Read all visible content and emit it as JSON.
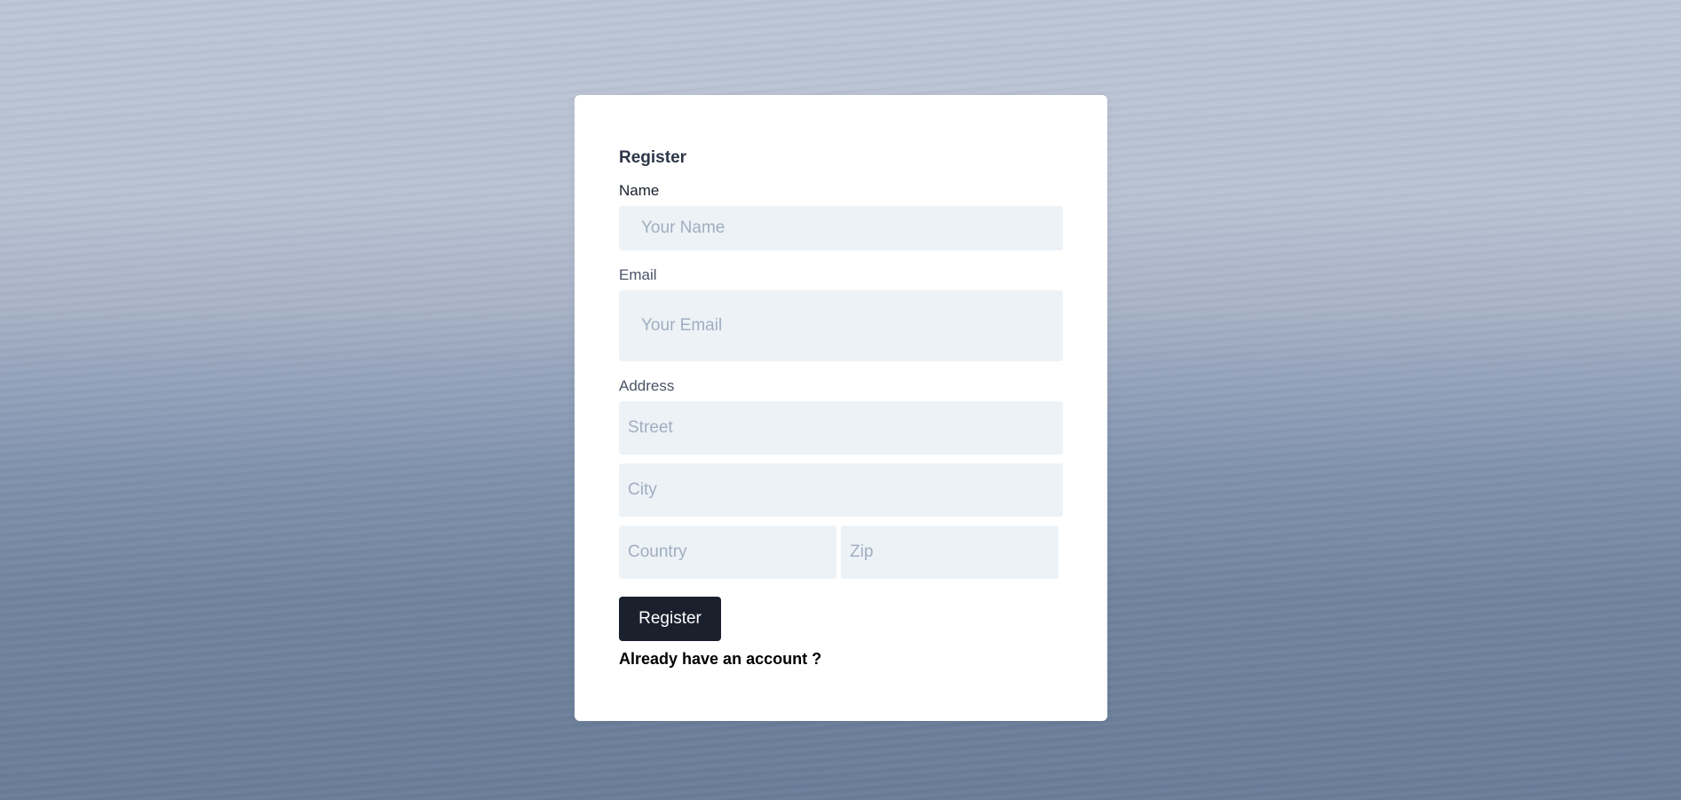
{
  "form": {
    "title": "Register",
    "name_label": "Name",
    "name_placeholder": "Your Name",
    "email_label": "Email",
    "email_placeholder": "Your Email",
    "address_label": "Address",
    "street_placeholder": "Street",
    "city_placeholder": "City",
    "country_placeholder": "Country",
    "zip_placeholder": "Zip",
    "submit_label": "Register",
    "login_link": "Already have an account ?"
  },
  "colors": {
    "button_bg": "#1a202c",
    "input_bg": "#edf2f7",
    "placeholder": "#a0aec0"
  }
}
